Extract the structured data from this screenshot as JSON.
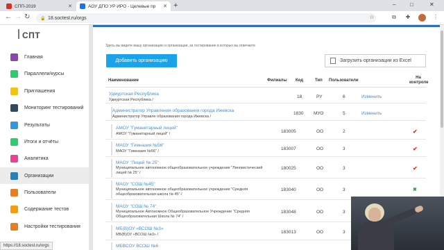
{
  "browser": {
    "tabs": [
      {
        "title": "СПП-2019",
        "active": false,
        "favicon_color": "#d93025"
      },
      {
        "title": "АОУ ДПО УР ИРО - Целевые пр",
        "active": true,
        "favicon_color": "#1a73e8"
      }
    ],
    "new_tab": "+",
    "url": "18.soctest.ru/orgs",
    "window_controls": [
      "–",
      "□",
      "✕"
    ]
  },
  "sidebar": {
    "logo": "СПТ",
    "items": [
      {
        "label": "Главная",
        "color": "#8e44ad",
        "active": false
      },
      {
        "label": "Параллели/курсы",
        "color": "#2ecc71",
        "active": false
      },
      {
        "label": "Приглашения",
        "color": "#f1c40f",
        "active": false
      },
      {
        "label": "Мониторинг тестирований",
        "color": "#34495e",
        "active": false
      },
      {
        "label": "Результаты",
        "color": "#3498db",
        "active": false
      },
      {
        "label": "Итоги и отчёты",
        "color": "#2ecc71",
        "active": false
      },
      {
        "label": "Аналитика",
        "color": "#e84393",
        "active": false
      },
      {
        "label": "Организации",
        "color": "#2980b9",
        "active": true
      },
      {
        "label": "Пользователи",
        "color": "#e67e22",
        "active": false
      },
      {
        "label": "Содержание тестов",
        "color": "#f39c12",
        "active": false
      },
      {
        "label": "Настройки тестирования",
        "color": "#e67e22",
        "active": false
      }
    ]
  },
  "main": {
    "hint": "Здесь вы видите вашу организацию и организации, за тестирование в которых вы отвечаете",
    "add_button": "Добавить организацию",
    "upload_button": "Загрузить организации из Excel",
    "columns": {
      "name": "Наименование",
      "branches": "Филиалы",
      "code": "Код",
      "type": "Тип",
      "users": "Пользователи",
      "control": "На контроле"
    },
    "rows": [
      {
        "link": "Удмуртская Республика",
        "sub": "Удмуртская Республика /",
        "code": "18",
        "type": "РУ",
        "users": "6",
        "edit": "Изменить",
        "mark": ""
      },
      {
        "link": "Администратор Управления образования города Ижевска",
        "sub": "Администратор Управле образования города Ижевска /",
        "code": "1830",
        "type": "МУО",
        "users": "5",
        "edit": "Изменить",
        "mark": ""
      },
      {
        "link": "АМОУ \"Гуманитарный лицей\"",
        "sub": "АМОУ \"Гуманитарный лицей\" /",
        "code": "183005",
        "type": "ОО",
        "users": "2",
        "edit": "",
        "mark": "✔"
      },
      {
        "link": "МАОУ \"Гимназия №56\"",
        "sub": "МАОУ \"Гимназия №56\" /",
        "code": "183007",
        "type": "ОО",
        "users": "3",
        "edit": "",
        "mark": "✔"
      },
      {
        "link": "МАОУ \"Лицей № 25\"",
        "sub": "Муниципальное автономное общеобразовательное учреждение \"Лингвистический лицей № 25\" /",
        "code": "180025",
        "type": "ОО",
        "users": "3",
        "edit": "",
        "mark": "✔"
      },
      {
        "link": "МАОУ \"СОШ №45\"",
        "sub": "Муниципальное автономное общеобразовательное учреждение \"Средняя общеобразовательная школа № 45\" /",
        "code": "183040",
        "type": "ОО",
        "users": "3",
        "edit": "",
        "mark": "✖"
      },
      {
        "link": "МАОУ \"СОШ № 74\"",
        "sub": "Муниципальное Автономное Общеобразовательное Учреждение \"Средняя Общеобразовательная Школа № 74\" /",
        "code": "183048",
        "type": "ОО",
        "users": "3",
        "edit": "",
        "mark": ""
      },
      {
        "link": "МБ(В)ОУ «ВСОШ №3»",
        "sub": "МБ(В)ОУ «ВСОШ №3» /",
        "code": "183013",
        "type": "ОО",
        "users": "3",
        "edit": "",
        "mark": ""
      },
      {
        "link": "МБВСОУ ВСОШ №6",
        "sub": "",
        "code": "",
        "type": "",
        "users": "",
        "edit": "",
        "mark": ""
      }
    ]
  },
  "statusbar": "https://18.soctest.ru/orgs",
  "colors": {
    "accent": "#1aa3e8",
    "link": "#4a8fd0",
    "check": "#d9302c",
    "cross": "#2e9e4f"
  }
}
